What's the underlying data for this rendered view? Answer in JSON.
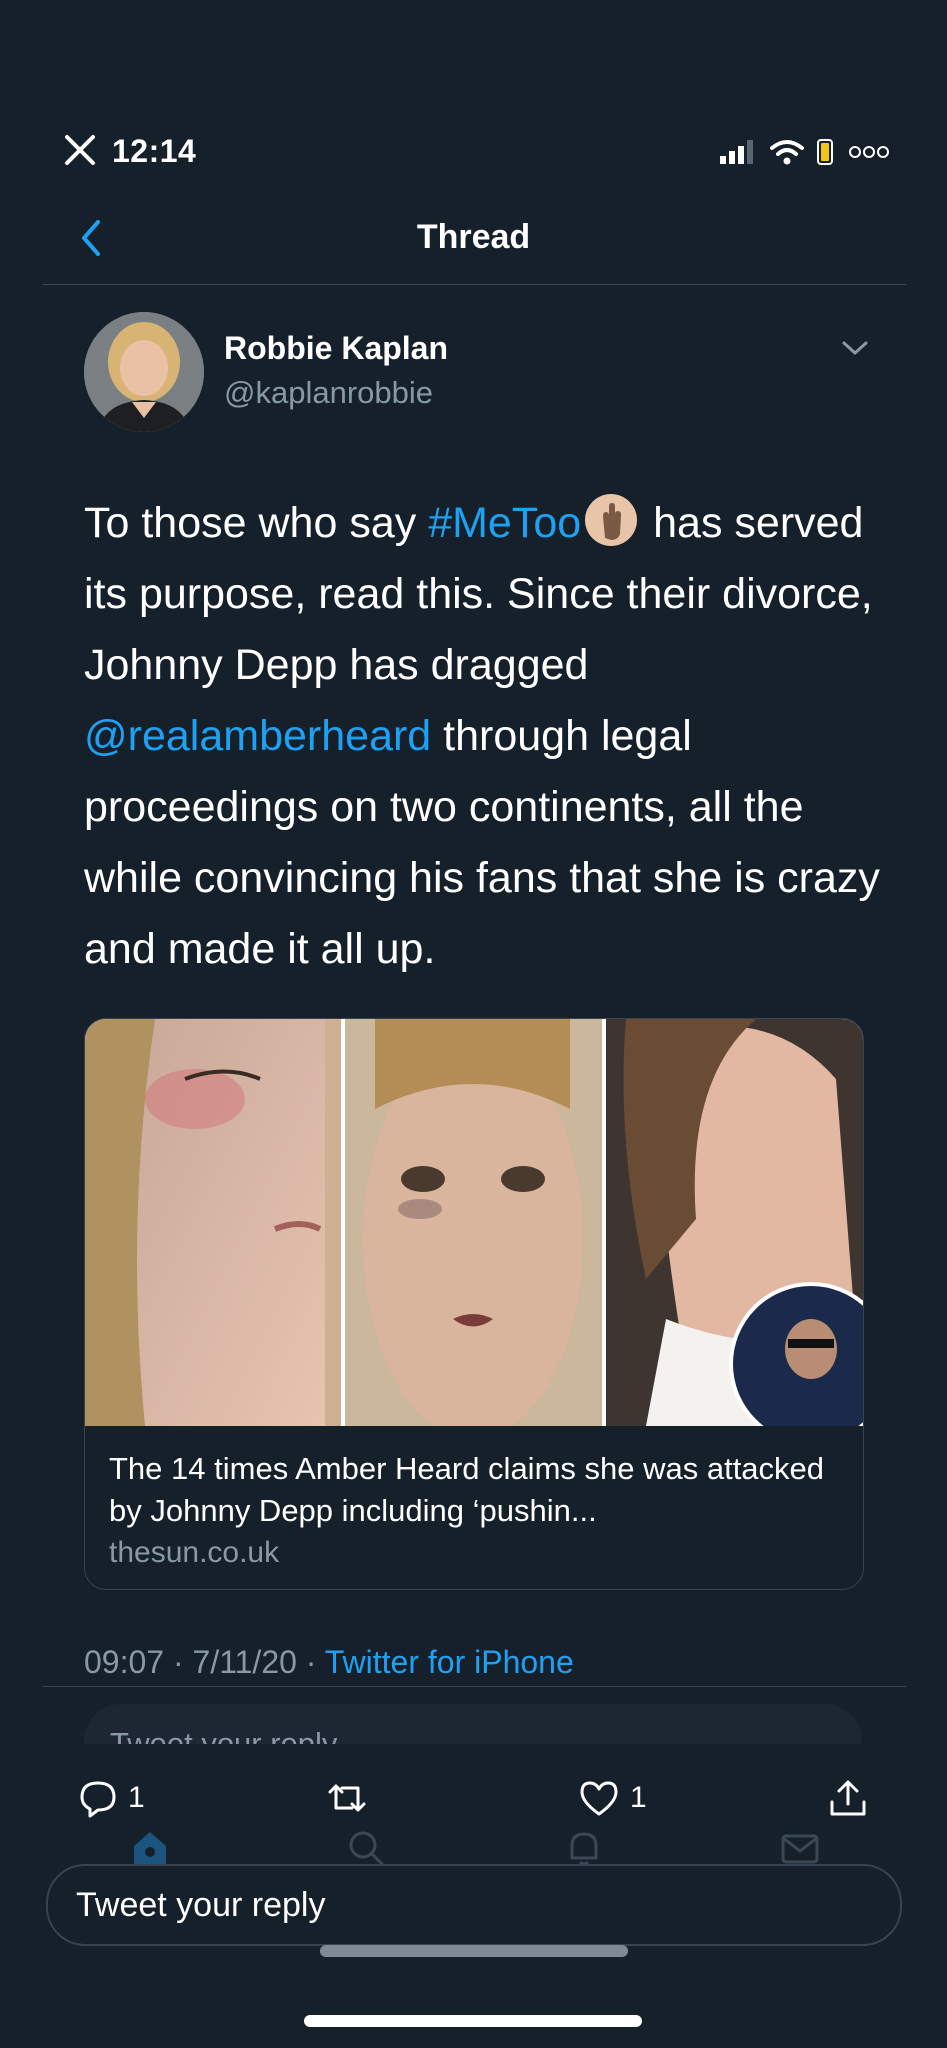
{
  "status_bar": {
    "time": "12:14",
    "icons": [
      "close-icon",
      "signal-icon",
      "wifi-icon",
      "battery-icon",
      "more-dots-icon"
    ]
  },
  "header": {
    "title": "Thread"
  },
  "tweet": {
    "author_name": "Robbie Kaplan",
    "author_handle": "@kaplanrobbie",
    "text": {
      "part1": "To those who say ",
      "hashtag": "#MeToo",
      "part2": " has served its purpose, read this. Since their divorce, Johnny Depp has dragged ",
      "mention": "@realamberheard",
      "part3": " through legal proceedings on two continents, all the while convincing his fans that she is crazy and made it all up."
    },
    "card": {
      "title": "The 14 times Amber Heard claims she was attacked by Johnny Depp including ‘pushin...",
      "domain": "thesun.co.uk"
    },
    "meta": {
      "time": "09:07",
      "separator": " · ",
      "date": "7/11/20",
      "source": "Twitter for iPhone"
    },
    "actions": {
      "reply_count": "1",
      "like_count": "1"
    }
  },
  "reply": {
    "ghost_placeholder": "Tweet your reply",
    "placeholder": "Tweet your reply"
  },
  "colors": {
    "background": "#15202b",
    "accent": "#1da1f2",
    "muted": "#8899a6",
    "divider": "#38444d"
  }
}
